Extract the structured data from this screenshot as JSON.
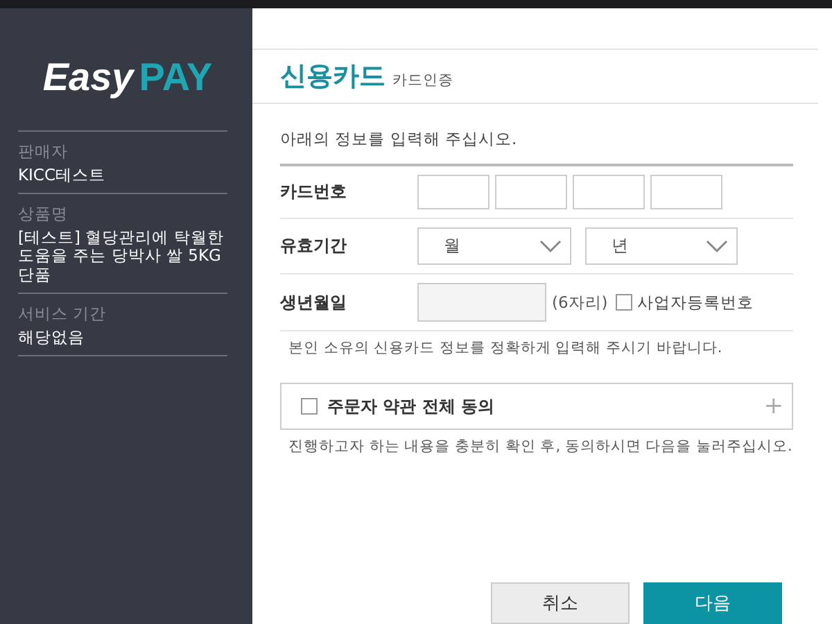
{
  "sidebar": {
    "logo": {
      "part_1": "Easy",
      "part_2": "PAY"
    },
    "fields": [
      {
        "label": "판매자",
        "value": "KICC테스트"
      },
      {
        "label": "상품명",
        "value": "[테스트] 혈당관리에 탁월한 도움을 주는 당박사 쌀 5KG 단품"
      },
      {
        "label": "서비스 기간",
        "value": "해당없음"
      }
    ]
  },
  "header": {
    "title": "신용카드",
    "subtitle": "카드인증"
  },
  "intro": "아래의 정보를 입력해 주십시오.",
  "form": {
    "card_number": {
      "label": "카드번호"
    },
    "expiry": {
      "label": "유효기간",
      "month_placeholder": "월",
      "year_placeholder": "년"
    },
    "birth": {
      "label": "생년월일",
      "hint": "(6자리)",
      "business_checkbox": {
        "label": "사업자등록번호",
        "checked": false
      }
    },
    "note": "본인 소유의 신용카드 정보를 정확하게 입력해 주시기 바랍니다."
  },
  "agreement": {
    "label": "주문자 약관 전체 동의",
    "checked": false,
    "expand": "+",
    "note": "진행하고자 하는 내용을 충분히 확인 후, 동의하시면 다음을 눌러주십시오."
  },
  "buttons": [
    {
      "label": "취소",
      "kind": "secondary"
    },
    {
      "label": "다음",
      "kind": "primary"
    }
  ]
}
